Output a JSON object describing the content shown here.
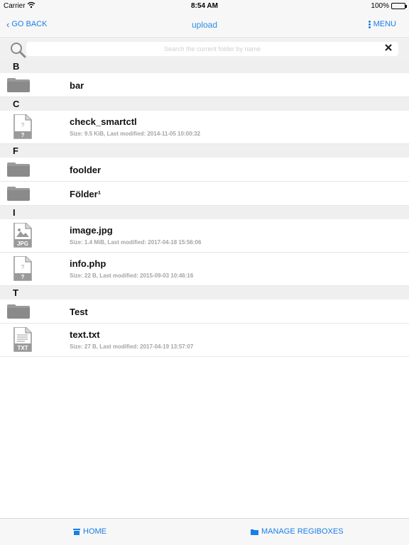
{
  "status_bar": {
    "carrier": "Carrier",
    "time": "8:54 AM",
    "battery": "100%"
  },
  "nav": {
    "back_label": "GO BACK",
    "title": "upload",
    "menu_label": "MENU"
  },
  "search": {
    "placeholder": "Search the current folder by name",
    "value": ""
  },
  "sections": [
    {
      "letter": "B",
      "items": [
        {
          "type": "folder",
          "name": "bar"
        }
      ]
    },
    {
      "letter": "C",
      "items": [
        {
          "type": "unknown",
          "name": "check_smartctl",
          "meta": "Size: 9.5 KiB, Last modified: 2014-11-05 10:00:32"
        }
      ]
    },
    {
      "letter": "F",
      "items": [
        {
          "type": "folder",
          "name": "foolder"
        },
        {
          "type": "folder",
          "name": "Földer¹"
        }
      ]
    },
    {
      "letter": "I",
      "items": [
        {
          "type": "jpg",
          "name": "image.jpg",
          "meta": "Size: 1.4 MiB, Last modified: 2017-04-18 15:56:06"
        },
        {
          "type": "unknown",
          "name": "info.php",
          "meta": "Size: 22 B, Last modified: 2015-09-03 10:46:16"
        }
      ]
    },
    {
      "letter": "T",
      "items": [
        {
          "type": "folder",
          "name": "Test"
        },
        {
          "type": "txt",
          "name": "text.txt",
          "meta": "Size: 27 B, Last modified: 2017-04-19 13:57:07"
        }
      ]
    }
  ],
  "tab_bar": {
    "home_label": "HOME",
    "manage_label": "MANAGE REGIBOXES"
  },
  "colors": {
    "accent": "#1a7ee8",
    "section_bg": "#efefef",
    "icon_gray": "#9a9a9a"
  },
  "icons": {
    "folder": "folder-icon",
    "unknown": "unknown-file-icon",
    "jpg": "jpg-file-icon",
    "txt": "txt-file-icon"
  }
}
